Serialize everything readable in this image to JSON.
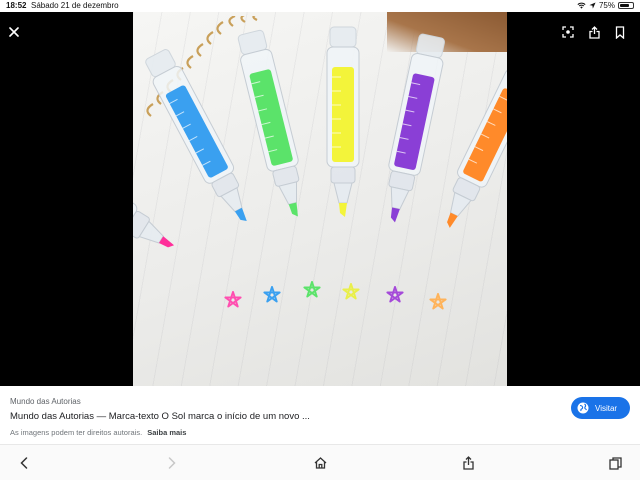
{
  "status_bar": {
    "time": "18:52",
    "date": "Sábado 21 de dezembro",
    "battery": "75%",
    "battery_level": 0.75
  },
  "viewer": {
    "close_icon": "close-icon",
    "actions": [
      "lens-icon",
      "share-icon",
      "bookmark-icon"
    ],
    "image": {
      "subject": "syringe-highlighter-pens",
      "pen_colors": [
        "#ff2f9a",
        "#3aa0f0",
        "#5be36a",
        "#f3f43a",
        "#8a3fd6",
        "#ff8a2a"
      ],
      "star_colors": [
        "#ff4fb0",
        "#3aa0f0",
        "#5be36a",
        "#e9ef4a",
        "#a54ad9",
        "#ffb35a"
      ]
    }
  },
  "info": {
    "source": "Mundo das Autorias",
    "title": "Mundo das Autorias — Marca-texto O Sol marca o início de um novo ...",
    "copyright_notice": "As imagens podem ter direitos autorais.",
    "learn_more": "Saiba mais",
    "visit_label": "Visitar"
  },
  "toolbar": {
    "icons": [
      "back-icon",
      "forward-icon",
      "home-icon",
      "share-icon",
      "tabs-icon"
    ]
  },
  "colors": {
    "accent": "#1a73e8",
    "viewer_bg": "#000000"
  }
}
